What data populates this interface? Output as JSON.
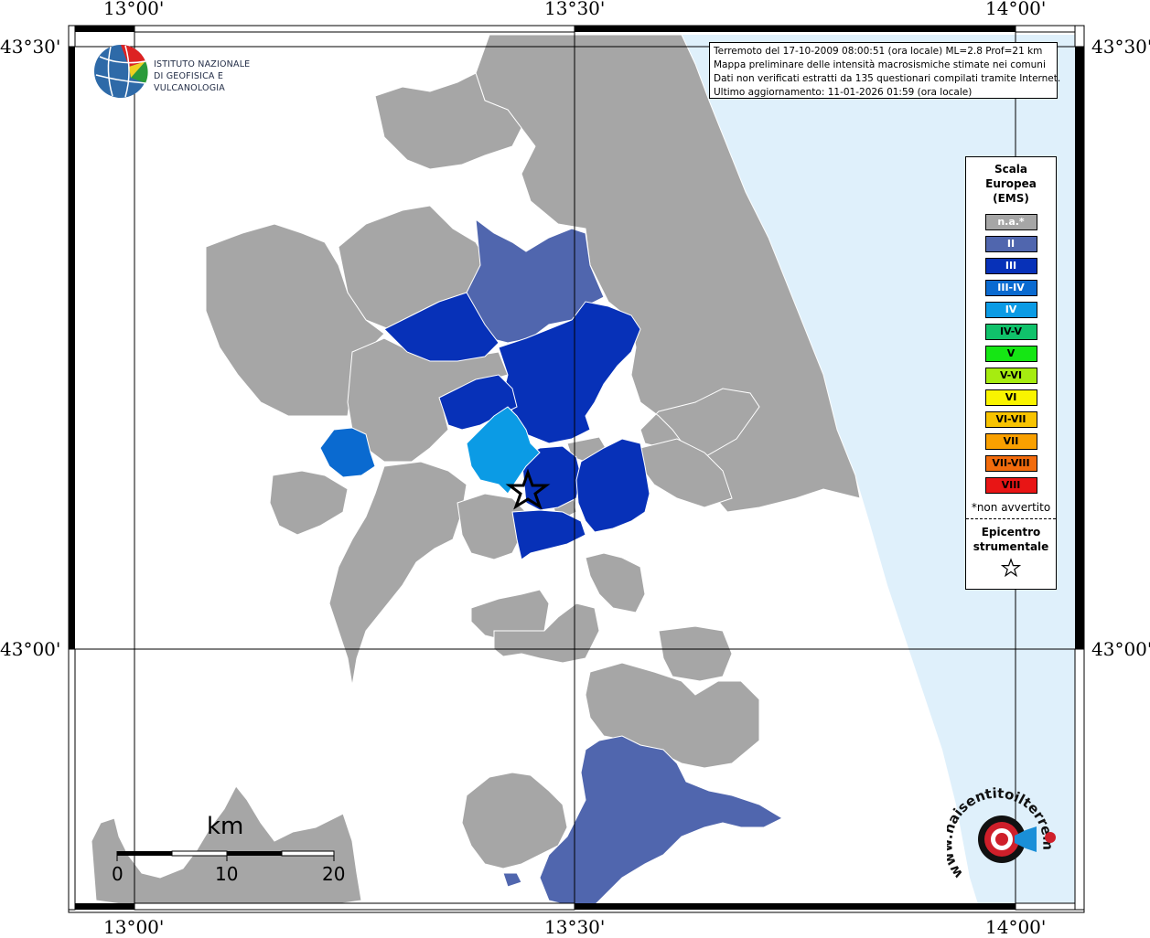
{
  "axes": {
    "top": [
      "13°00'",
      "13°30'",
      "14°00'"
    ],
    "bottom": [
      "13°00'",
      "13°30'",
      "14°00'"
    ],
    "left": [
      "43°30'",
      "43°00'"
    ],
    "right": [
      "43°30'",
      "43°00'"
    ]
  },
  "info": {
    "line1": "Terremoto del 17-10-2009 08:00:51 (ora locale) ML=2.8 Prof=21 km",
    "line2": "Mappa preliminare delle intensità macrosismiche stimate nei comuni",
    "line3": "Dati non verificati estratti da 135 questionari compilati tramite Internet.",
    "line4": "Ultimo aggiornamento: 11-01-2026 01:59 (ora locale)"
  },
  "logo": {
    "line1": "ISTITUTO NAZIONALE",
    "line2": "DI GEOFISICA E VULCANOLOGIA"
  },
  "legend": {
    "title1": "Scala",
    "title2": "Europea",
    "title3": "(EMS)",
    "items": [
      {
        "label": "n.a.*",
        "color": "#a6a6a6"
      },
      {
        "label": "II",
        "color": "#5066ae"
      },
      {
        "label": "III",
        "color": "#0731b8"
      },
      {
        "label": "III-IV",
        "color": "#0a6ad0"
      },
      {
        "label": "IV",
        "color": "#0b9be5"
      },
      {
        "label": "IV-V",
        "color": "#10c26b"
      },
      {
        "label": "V",
        "color": "#15e614"
      },
      {
        "label": "V-VI",
        "color": "#a6ec10"
      },
      {
        "label": "VI",
        "color": "#f9f400"
      },
      {
        "label": "VI-VII",
        "color": "#f7c300"
      },
      {
        "label": "VII",
        "color": "#f9a000"
      },
      {
        "label": "VII-VIII",
        "color": "#f26b0c"
      },
      {
        "label": "VIII",
        "color": "#e81515"
      }
    ],
    "note": "*non avvertito",
    "epicenter1": "Epicentro",
    "epicenter2": "strumentale"
  },
  "scalebar": {
    "title": "km",
    "ticks": [
      "0",
      "10",
      "20"
    ]
  },
  "hai_logo": {
    "text": "www.haisentitoilterremoto.it"
  },
  "colors": {
    "sea": "#dff0fb",
    "na": "#a6a6a6",
    "II": "#5066ae",
    "III": "#0731b8",
    "III_IV": "#0a6ad0",
    "IV": "#0b9be5"
  }
}
